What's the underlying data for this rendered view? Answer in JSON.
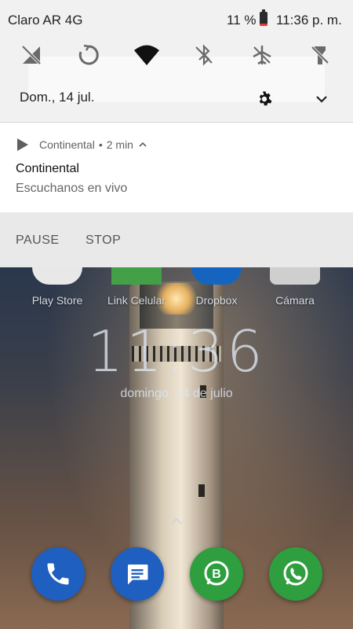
{
  "status_bar": {
    "carrier": "Claro AR 4G",
    "battery_percent": "11 %",
    "time": "11:36 p. m."
  },
  "quick_settings": {
    "tiles": [
      {
        "icon": "mobile-data-off-icon",
        "active": false
      },
      {
        "icon": "auto-rotate-icon",
        "active": false
      },
      {
        "icon": "wifi-icon",
        "active": true
      },
      {
        "icon": "bluetooth-off-icon",
        "active": false
      },
      {
        "icon": "airplane-mode-off-icon",
        "active": false
      },
      {
        "icon": "flashlight-off-icon",
        "active": false
      }
    ],
    "date": "Dom., 14 jul."
  },
  "notification": {
    "app_name": "Continental",
    "age": "2 min",
    "title": "Continental",
    "text": "Escuchanos en vivo",
    "actions": {
      "pause": "PAUSE",
      "stop": "STOP"
    }
  },
  "home": {
    "apps": [
      {
        "label": "Play Store",
        "color": "#e8e8e8"
      },
      {
        "label": "Link Celular",
        "color": "#43a047"
      },
      {
        "label": "Dropbox",
        "color": "#1565c0"
      },
      {
        "label": "Cámara",
        "color": "#cfcfcf"
      }
    ],
    "clock": "11:36",
    "date": "domingo, 14 de julio",
    "dock": [
      {
        "icon": "phone-icon",
        "color": "#1e5fc0"
      },
      {
        "icon": "messages-icon",
        "color": "#1e5fc0"
      },
      {
        "icon": "whatsapp-business-icon",
        "color": "#2e9e3e"
      },
      {
        "icon": "whatsapp-icon",
        "color": "#2e9e3e"
      }
    ]
  },
  "colors": {
    "shade_bg": "#f1f1f1",
    "card_bg": "#ffffff",
    "actions_bg": "#e9e9e9",
    "battery_low": "#e53935"
  }
}
